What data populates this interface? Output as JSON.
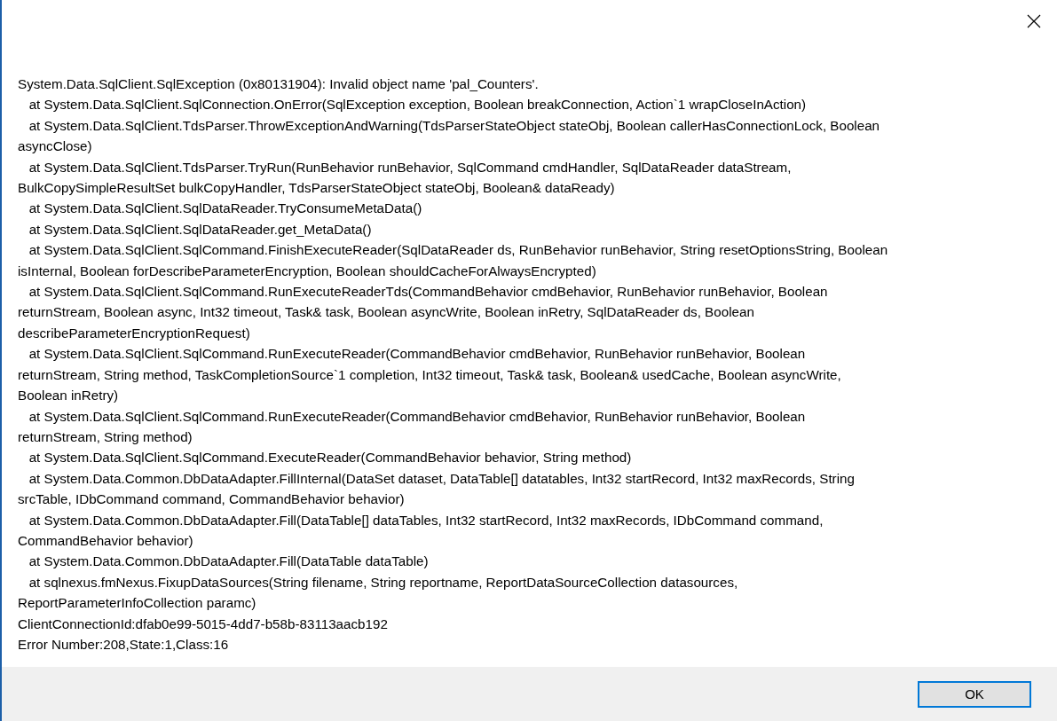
{
  "dialog": {
    "message_lines": [
      "System.Data.SqlClient.SqlException (0x80131904): Invalid object name 'pal_Counters'.",
      "   at System.Data.SqlClient.SqlConnection.OnError(SqlException exception, Boolean breakConnection, Action`1 wrapCloseInAction)",
      "   at System.Data.SqlClient.TdsParser.ThrowExceptionAndWarning(TdsParserStateObject stateObj, Boolean callerHasConnectionLock, Boolean",
      "asyncClose)",
      "   at System.Data.SqlClient.TdsParser.TryRun(RunBehavior runBehavior, SqlCommand cmdHandler, SqlDataReader dataStream,",
      "BulkCopySimpleResultSet bulkCopyHandler, TdsParserStateObject stateObj, Boolean& dataReady)",
      "   at System.Data.SqlClient.SqlDataReader.TryConsumeMetaData()",
      "   at System.Data.SqlClient.SqlDataReader.get_MetaData()",
      "   at System.Data.SqlClient.SqlCommand.FinishExecuteReader(SqlDataReader ds, RunBehavior runBehavior, String resetOptionsString, Boolean",
      "isInternal, Boolean forDescribeParameterEncryption, Boolean shouldCacheForAlwaysEncrypted)",
      "   at System.Data.SqlClient.SqlCommand.RunExecuteReaderTds(CommandBehavior cmdBehavior, RunBehavior runBehavior, Boolean",
      "returnStream, Boolean async, Int32 timeout, Task& task, Boolean asyncWrite, Boolean inRetry, SqlDataReader ds, Boolean",
      "describeParameterEncryptionRequest)",
      "   at System.Data.SqlClient.SqlCommand.RunExecuteReader(CommandBehavior cmdBehavior, RunBehavior runBehavior, Boolean",
      "returnStream, String method, TaskCompletionSource`1 completion, Int32 timeout, Task& task, Boolean& usedCache, Boolean asyncWrite,",
      "Boolean inRetry)",
      "   at System.Data.SqlClient.SqlCommand.RunExecuteReader(CommandBehavior cmdBehavior, RunBehavior runBehavior, Boolean",
      "returnStream, String method)",
      "   at System.Data.SqlClient.SqlCommand.ExecuteReader(CommandBehavior behavior, String method)",
      "   at System.Data.Common.DbDataAdapter.FillInternal(DataSet dataset, DataTable[] datatables, Int32 startRecord, Int32 maxRecords, String",
      "srcTable, IDbCommand command, CommandBehavior behavior)",
      "   at System.Data.Common.DbDataAdapter.Fill(DataTable[] dataTables, Int32 startRecord, Int32 maxRecords, IDbCommand command,",
      "CommandBehavior behavior)",
      "   at System.Data.Common.DbDataAdapter.Fill(DataTable dataTable)",
      "   at sqlnexus.fmNexus.FixupDataSources(String filename, String reportname, ReportDataSourceCollection datasources,",
      "ReportParameterInfoCollection paramc)",
      "ClientConnectionId:dfab0e99-5015-4dd7-b58b-83113aacb192",
      "Error Number:208,State:1,Class:16"
    ],
    "ok_button": {
      "label": "OK",
      "focused": true
    }
  }
}
